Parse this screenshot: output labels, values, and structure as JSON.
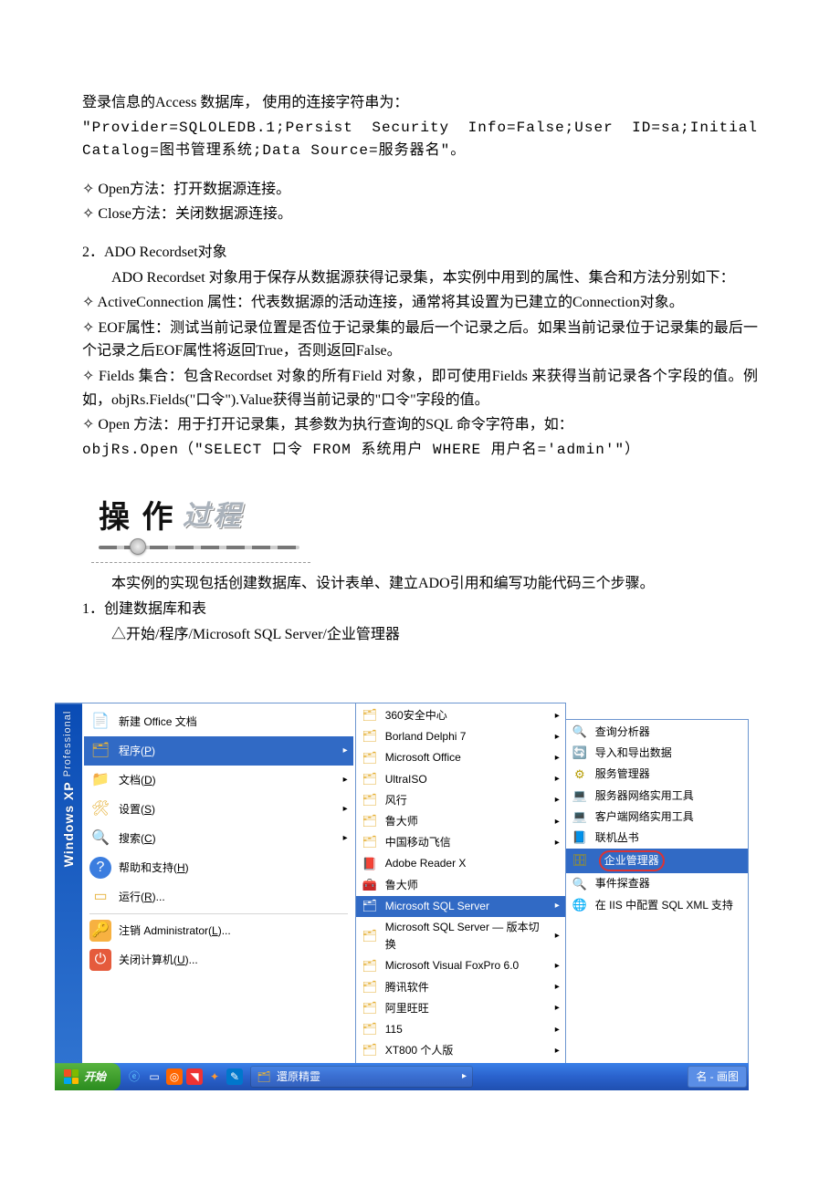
{
  "doc": {
    "p1": "登录信息的Access 数据库， 使用的连接字符串为：",
    "p2": "\"Provider=SQLOLEDB.1;Persist Security Info=False;User ID=sa;Initial Catalog=图书管理系统;Data Source=服务器名\"。",
    "d1": "Open方法：打开数据源连接。",
    "d2": " Close方法：关闭数据源连接。",
    "h2": "2．ADO Recordset对象",
    "p3": "ADO Recordset 对象用于保存从数据源获得记录集，本实例中用到的属性、集合和方法分别如下：",
    "d3": " ActiveConnection 属性：代表数据源的活动连接，通常将其设置为已建立的Connection对象。",
    "d4": "EOF属性：测试当前记录位置是否位于记录集的最后一个记录之后。如果当前记录位于记录集的最后一个记录之后EOF属性将返回True，否则返回False。",
    "d5": "Fields 集合：包含Recordset 对象的所有Field 对象，即可使用Fields 来获得当前记录各个字段的值。例如，objRs.Fields(\"口令\").Value获得当前记录的\"口令\"字段的值。",
    "d6": "Open 方法：用于打开记录集，其参数为执行查询的SQL 命令字符串，如：",
    "p4": "objRs.Open（\"SELECT 口令 FROM 系统用户 WHERE 用户名='admin'\"）",
    "bannerBig": "操 作",
    "bannerItalic": "过程",
    "p5": "本实例的实现包括创建数据库、设计表单、建立ADO引用和编写功能代码三个步骤。",
    "h3": "1．创建数据库和表",
    "p6": "开始/程序/Microsoft SQL Server/企业管理器"
  },
  "startmenu": {
    "sidebar_top": "Professional",
    "sidebar_bottom": "Windows XP",
    "left": [
      {
        "icon": "📄",
        "label": "新建 Office 文档",
        "arrow": false
      },
      {
        "icon": "🗂",
        "label": "程序",
        "hot": "P",
        "arrow": true,
        "hover": true
      },
      {
        "icon": "📁",
        "label": "文档",
        "hot": "D",
        "arrow": true
      },
      {
        "icon": "🛠",
        "label": "设置",
        "hot": "S",
        "arrow": true
      },
      {
        "icon": "🔍",
        "label": "搜索",
        "hot": "C",
        "arrow": true
      },
      {
        "icon": "?",
        "label": "帮助和支持",
        "hot": "H",
        "arrow": false,
        "help": true
      },
      {
        "icon": "▭",
        "label": "运行",
        "hot": "R",
        "suffix": "...",
        "arrow": false
      },
      {
        "sep": true
      },
      {
        "icon": "🔑",
        "label": "注销 Administrator",
        "hot": "L",
        "suffix": "...",
        "arrow": false,
        "cls": "ico-logoff"
      },
      {
        "icon": "⏻",
        "label": "关闭计算机",
        "hot": "U",
        "suffix": "...",
        "arrow": false,
        "cls": "ico-shut"
      }
    ],
    "middle": [
      {
        "icon": "🗂",
        "label": "360安全中心",
        "arrow": true
      },
      {
        "icon": "🗂",
        "label": "Borland Delphi 7",
        "arrow": true
      },
      {
        "icon": "🗂",
        "label": "Microsoft Office",
        "arrow": true
      },
      {
        "icon": "🗂",
        "label": "UltraISO",
        "arrow": true
      },
      {
        "icon": "🗂",
        "label": "风行",
        "arrow": true
      },
      {
        "icon": "🗂",
        "label": "鲁大师",
        "arrow": true
      },
      {
        "icon": "🗂",
        "label": "中国移动飞信",
        "arrow": true
      },
      {
        "icon": "📕",
        "label": "Adobe Reader X",
        "arrow": false,
        "red": true
      },
      {
        "icon": "🧰",
        "label": "鲁大师",
        "arrow": false
      },
      {
        "icon": "🗂",
        "label": "Microsoft SQL Server",
        "arrow": true,
        "sel": true
      },
      {
        "icon": "🗂",
        "label": "Microsoft SQL Server — 版本切换",
        "arrow": true
      },
      {
        "icon": "🗂",
        "label": "Microsoft Visual FoxPro 6.0",
        "arrow": true
      },
      {
        "icon": "🗂",
        "label": "腾讯软件",
        "arrow": true
      },
      {
        "icon": "🗂",
        "label": "阿里旺旺",
        "arrow": true
      },
      {
        "icon": "🗂",
        "label": "115",
        "arrow": true
      },
      {
        "icon": "🗂",
        "label": "XT800 个人版",
        "arrow": true
      },
      {
        "icon": "🗂",
        "label": "還原精靈",
        "arrow": true
      }
    ],
    "middle_last_in_taskbar": "還原精靈",
    "right": [
      {
        "icon": "🔍",
        "label": "查询分析器"
      },
      {
        "icon": "🔄",
        "label": "导入和导出数据"
      },
      {
        "icon": "⚙",
        "label": "服务管理器"
      },
      {
        "icon": "💻",
        "label": "服务器网络实用工具"
      },
      {
        "icon": "💻",
        "label": "客户端网络实用工具"
      },
      {
        "icon": "📘",
        "label": "联机丛书"
      },
      {
        "icon": "🗄",
        "label": "企业管理器",
        "circled": true,
        "hl": true
      },
      {
        "icon": "🔍",
        "label": "事件探查器"
      },
      {
        "icon": "🌐",
        "label": "在 IIS 中配置 SQL XML 支持"
      }
    ]
  },
  "taskbar": {
    "start": "开始",
    "task": "名 - 画图"
  }
}
